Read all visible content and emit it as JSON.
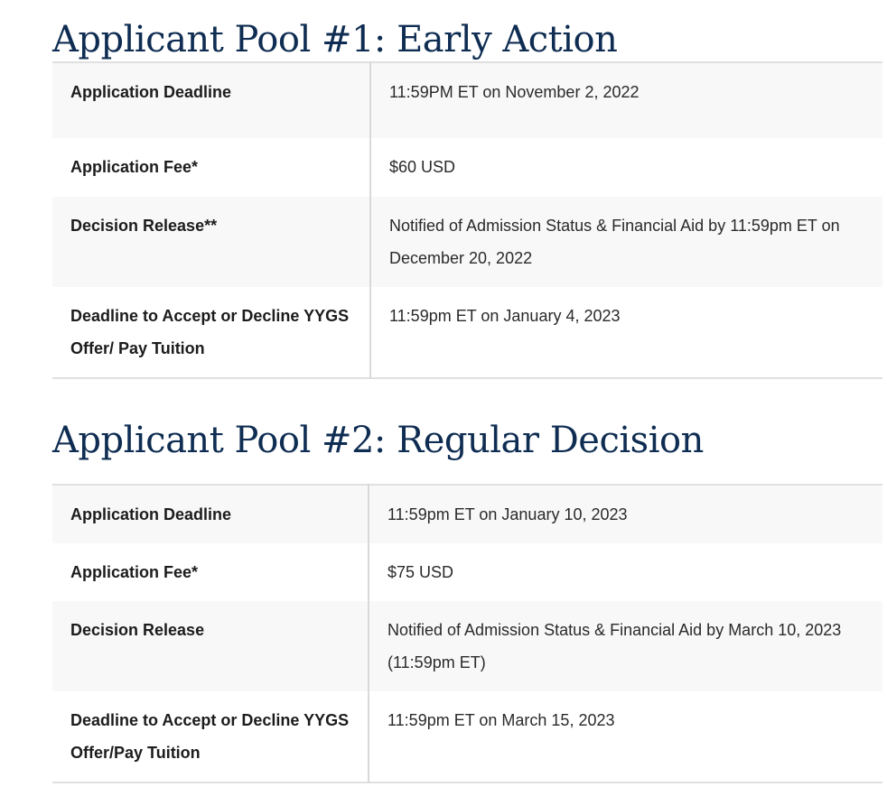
{
  "pools": [
    {
      "title": "Applicant Pool #1: Early Action",
      "rows": [
        {
          "label": "Application Deadline",
          "value": "11:59PM ET on November 2, 2022"
        },
        {
          "label": "Application Fee*",
          "value": "$60 USD"
        },
        {
          "label": "Decision Release**",
          "value": "Notified of Admission Status & Financial Aid by 11:59pm ET on December 20, 2022"
        },
        {
          "label": "Deadline to Accept or Decline YYGS Offer/ Pay Tuition",
          "value": "11:59pm ET on January 4, 2023"
        }
      ]
    },
    {
      "title": "Applicant Pool #2: Regular Decision",
      "rows": [
        {
          "label": "Application Deadline",
          "value": "11:59pm ET on January 10, 2023"
        },
        {
          "label": "Application Fee*",
          "value": "$75 USD"
        },
        {
          "label": "Decision Release",
          "value": "Notified of Admission Status & Financial Aid by March 10, 2023 (11:59pm ET)"
        },
        {
          "label": "Deadline to Accept or Decline YYGS Offer/Pay Tuition",
          "value": "11:59pm ET on March 15, 2023"
        }
      ]
    }
  ],
  "colors": {
    "title": "#0f2d52",
    "row_shade": "#f8f8f8",
    "divider": "#e0e0e0"
  }
}
